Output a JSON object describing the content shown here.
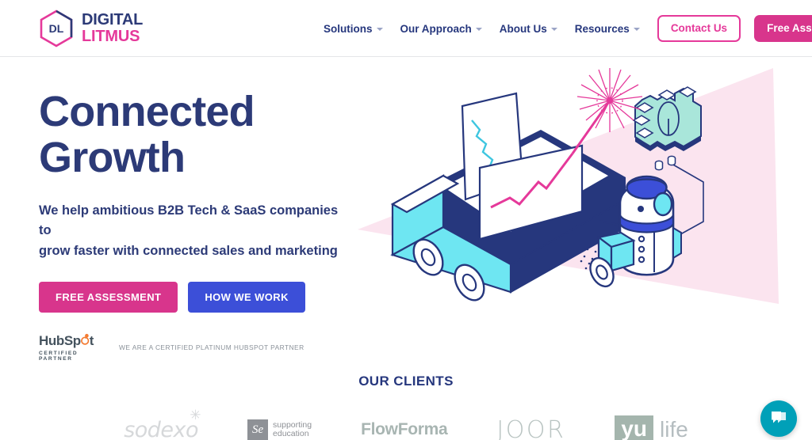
{
  "header": {
    "logo": {
      "mark_text": "DL",
      "line1": "DIGITAL",
      "line2": "LITMUS",
      "navy": "#2c3a77",
      "pink": "#e5399a"
    },
    "nav_items": [
      {
        "label": "Solutions",
        "has_caret": true
      },
      {
        "label": "Our Approach",
        "has_caret": true
      },
      {
        "label": "About Us",
        "has_caret": true
      },
      {
        "label": "Resources",
        "has_caret": true
      }
    ],
    "contact_button": "Contact Us",
    "assessment_button": "Free Assessment"
  },
  "hero": {
    "title_line1": "Connected",
    "title_line2": "Growth",
    "subtitle_line1": "We help ambitious B2B Tech & SaaS companies to",
    "subtitle_line2": "grow faster with connected sales and marketing",
    "cta_primary": "FREE ASSESSMENT",
    "cta_secondary": "HOW WE WORK",
    "partner": {
      "brand": "HubSp",
      "brand_tail": "t",
      "certified": "CERTIFIED PARTNER",
      "statement": "WE ARE A CERTIFIED PLATINUM HUBSPOT PARTNER"
    },
    "illustration_name": "isometric-cart-robot-gear-illustration"
  },
  "clients": {
    "title": "OUR CLIENTS",
    "logos": [
      {
        "name": "sodexo",
        "text": "sodexo",
        "star": "✳"
      },
      {
        "name": "supporting-education",
        "mark": "Se",
        "line1": "supporting",
        "line2": "education"
      },
      {
        "name": "flowforma",
        "text": "FlowForma"
      },
      {
        "name": "joor",
        "text": "JOOR"
      },
      {
        "name": "yulife",
        "box": "yu",
        "tail": "life"
      }
    ]
  },
  "chat": {
    "label": "chat-widget",
    "color": "#00a0b8"
  },
  "colors": {
    "navy": "#26377d",
    "pink": "#d8358c",
    "blue": "#3c4fd8",
    "cyan": "#6ee6f2",
    "mint": "#a9e6da",
    "pale_pink": "#fbe4ef"
  }
}
